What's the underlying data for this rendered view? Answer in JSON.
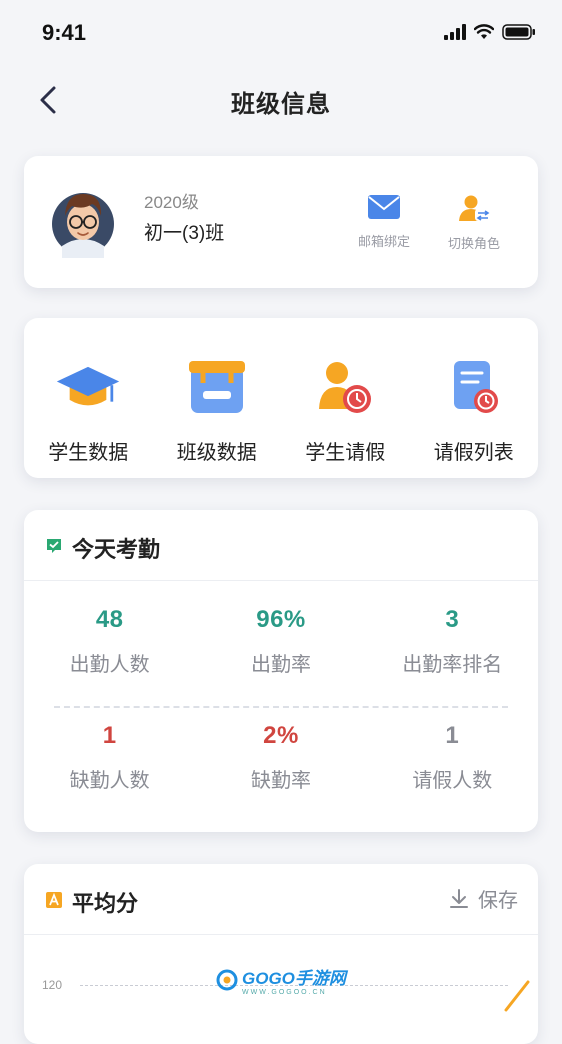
{
  "status_bar": {
    "time": "9:41"
  },
  "nav": {
    "title": "班级信息"
  },
  "profile": {
    "grade": "2020级",
    "class_name": "初一(3)班",
    "actions": [
      {
        "label": "邮箱绑定",
        "icon": "mail-icon"
      },
      {
        "label": "切换角色",
        "icon": "switch-user-icon"
      }
    ]
  },
  "menu": [
    {
      "label": "学生数据",
      "icon": "graduation-cap-icon"
    },
    {
      "label": "班级数据",
      "icon": "class-box-icon"
    },
    {
      "label": "学生请假",
      "icon": "student-leave-icon"
    },
    {
      "label": "请假列表",
      "icon": "leave-list-icon"
    }
  ],
  "attendance": {
    "title": "今天考勤",
    "stats": [
      {
        "value": "48",
        "label": "出勤人数"
      },
      {
        "value": "96%",
        "label": "出勤率"
      },
      {
        "value": "3",
        "label": "出勤率排名"
      },
      {
        "value": "1",
        "label": "缺勤人数"
      },
      {
        "value": "2%",
        "label": "缺勤率"
      },
      {
        "value": "1",
        "label": "请假人数"
      }
    ]
  },
  "average": {
    "title": "平均分",
    "save_label": "保存",
    "chart_tick": "120"
  },
  "watermark": {
    "text": "GOGO手游网",
    "sub": "WWW.GOGOO.CN"
  },
  "colors": {
    "teal": "#2a9a86",
    "red": "#d0453f",
    "gray_value": "#8a8c94",
    "accent_blue": "#4a86e8",
    "accent_orange": "#f6a623"
  }
}
